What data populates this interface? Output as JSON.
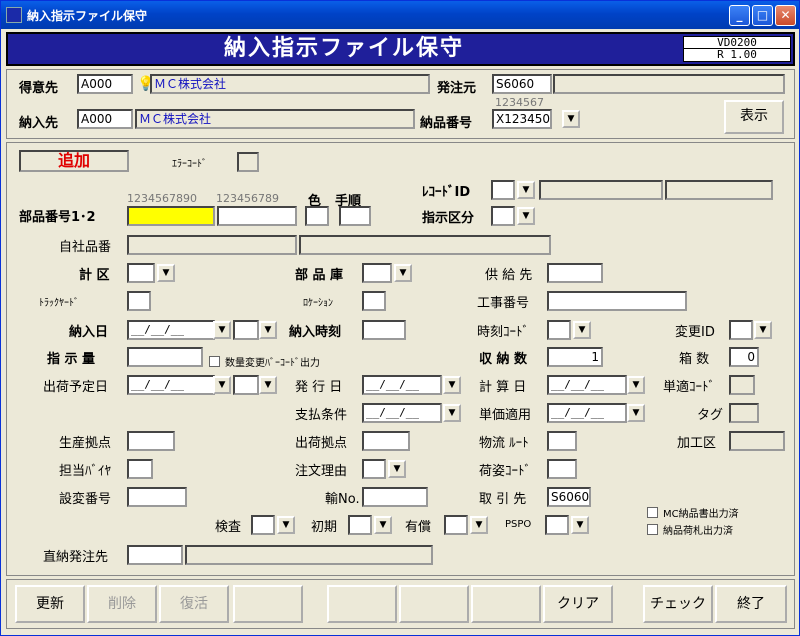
{
  "window": {
    "title": "納入指示ファイル保守",
    "banner": "納入指示ファイル保守",
    "ver1": "VD0200",
    "ver2": "R 1.00"
  },
  "header": {
    "tokui_label": "得意先",
    "tokui_code": "A000",
    "tokui_name": "ＭＣ株式会社",
    "hacchu_label": "発注元",
    "hacchu_code": "S6060",
    "nonyu_label": "納入先",
    "nonyu_code": "A000",
    "nonyu_name": "ＭＣ株式会社",
    "nohin_label": "納品番号",
    "nohin_hint": "1234567",
    "nohin_value": "X123450",
    "show_button": "表示"
  },
  "main": {
    "mode": "追加",
    "error_code_label": "ｴﾗｰｺｰﾄﾞ",
    "record_id_label": "ﾚｺｰﾄﾞID",
    "shiji_kubun_label": "指示区分",
    "hint_part1": "1234567890",
    "hint_part2": "123456789",
    "color_label": "色",
    "tejun_label": "手順",
    "part_label": "部品番号1･2",
    "jisha_label": "自社品番",
    "keiku_label": "計 区",
    "buhinko_label": "部 品 庫",
    "kyukyu_label": "供 給 先",
    "track_label": "ﾄﾗｯｸﾔｰﾄﾞ",
    "location_label": "ﾛｹｰｼｮﾝ",
    "koji_label": "工事番号",
    "nonyubi_label": "納入日",
    "nonyubi_value": "__/__/__",
    "nonyujikoku_label": "納入時刻",
    "jikoku_code_label": "時刻ｺｰﾄﾞ",
    "henko_id_label": "変更ID",
    "shiji_qty_label": "指 示 量",
    "qty_change_label": "数量変更ﾊﾞｰｺｰﾄﾞ出力",
    "shuno_label": "収 納 数",
    "shuno_value": "1",
    "hako_label": "箱 数",
    "hako_value": "0",
    "shukka_yotei_label": "出荷予定日",
    "shukka_yotei_value": "__/__/__",
    "hakko_label": "発 行 日",
    "hakko_value": "__/__/__",
    "keisan_label": "計 算 日",
    "keisan_value": "__/__/__",
    "tanteki_label": "単適ｺｰﾄﾞ",
    "shiharai_label": "支払条件",
    "shiharai_value": "__/__/__",
    "tanka_label": "単価適用",
    "tanka_value": "__/__/__",
    "tag_label": "タグ",
    "seisan_label": "生産拠点",
    "shukka_kyoten_label": "出荷拠点",
    "butsuryu_label": "物流 ﾙｰﾄ",
    "kako_label": "加工区",
    "tanto_label": "担当ﾊﾞｲﾔ",
    "chumon_label": "注文理由",
    "nisugata_label": "荷姿ｺｰﾄﾞ",
    "sekkei_label": "設変番号",
    "yusou_label": "輸No.",
    "torihiki_label": "取 引 先",
    "torihiki_value": "S6060",
    "kensa_label": "検査",
    "shoki_label": "初期",
    "yusho_label": "有償",
    "pspo_label": "PSPO",
    "mc_nohinsho_label": "MC納品書出力済",
    "nohin_nifuda_label": "納品荷札出力済",
    "chokuno_label": "直納発注先"
  },
  "footer": {
    "update": "更新",
    "delete": "削除",
    "restore": "復活",
    "clear": "クリア",
    "check": "チェック",
    "end": "終了"
  }
}
